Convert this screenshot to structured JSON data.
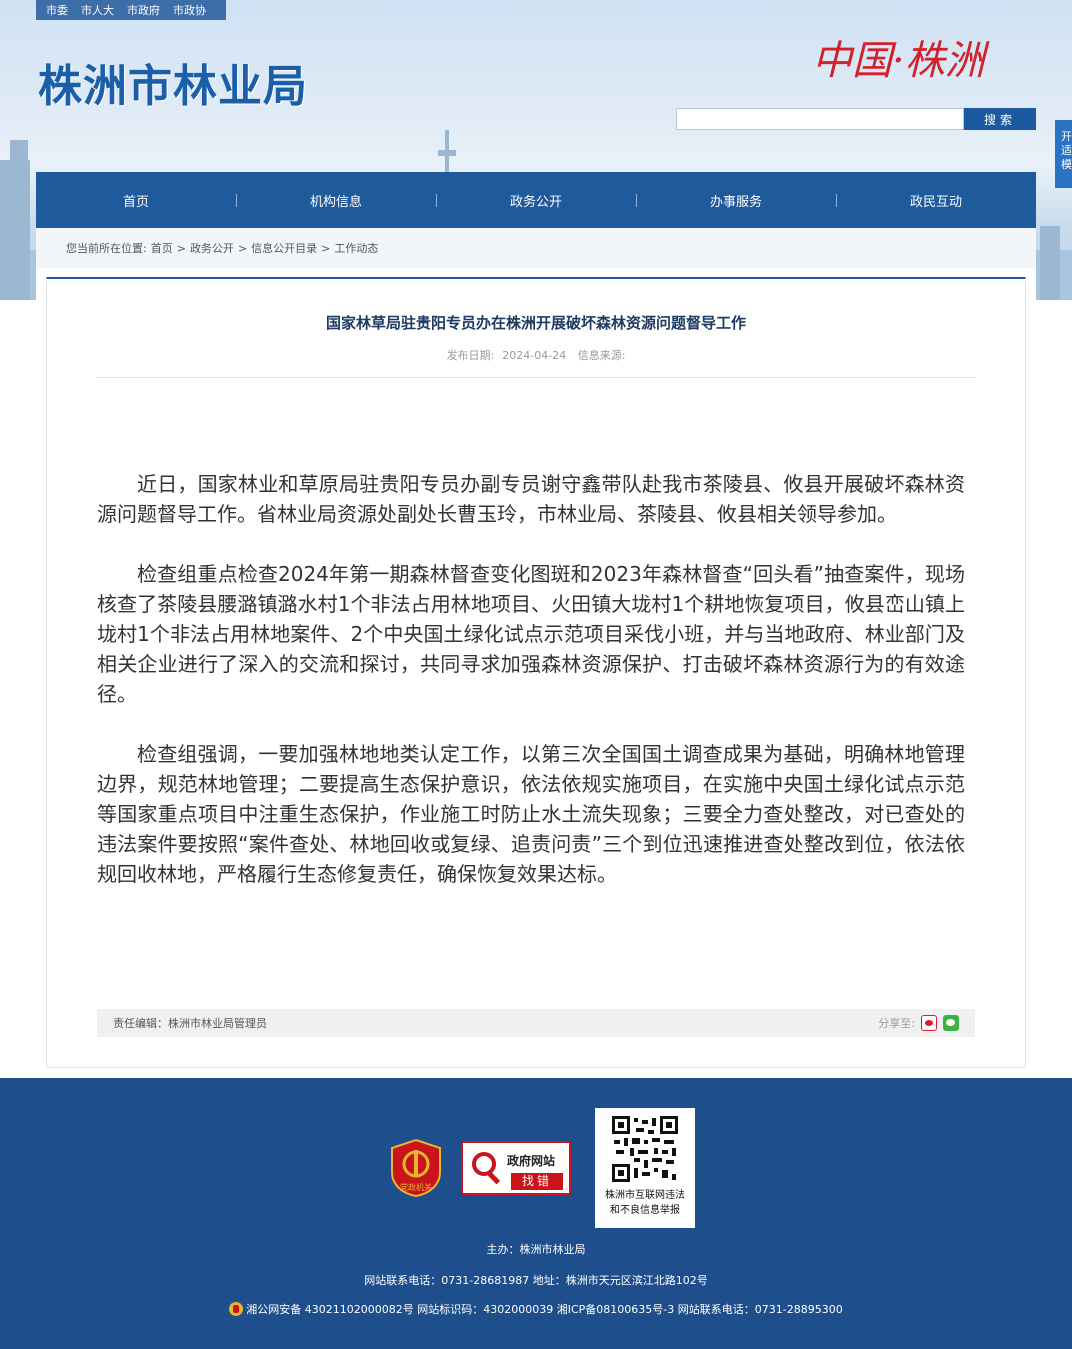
{
  "topbar": {
    "links": [
      "市委",
      "市人大",
      "市政府",
      "市政协"
    ]
  },
  "header": {
    "site_title": "株洲市林业局",
    "calligraphy": "中国·株洲",
    "search_button": "搜索",
    "side_float": "开 适 模"
  },
  "nav": {
    "items": [
      "首页",
      "机构信息",
      "政务公开",
      "办事服务",
      "政民互动"
    ]
  },
  "breadcrumb": {
    "prefix": "您当前所在位置:",
    "items": [
      "首页",
      "政务公开",
      "信息公开目录",
      "工作动态"
    ],
    "sep": ">"
  },
  "article": {
    "title": "国家林草局驻贵阳专员办在株洲开展破坏森林资源问题督导工作",
    "date_label": "发布日期:",
    "date": "2024-04-24",
    "source_label": "信息来源:",
    "paragraphs": [
      "近日，国家林业和草原局驻贵阳专员办副专员谢守鑫带队赴我市茶陵县、攸县开展破坏森林资源问题督导工作。省林业局资源处副处长曹玉玲，市林业局、茶陵县、攸县相关领导参加。",
      "检查组重点检查2024年第一期森林督查变化图斑和2023年森林督查“回头看”抽查案件，现场核查了茶陵县腰潞镇潞水村1个非法占用林地项目、火田镇大垅村1个耕地恢复项目，攸县峦山镇上垅村1个非法占用林地案件、2个中央国土绿化试点示范项目采伐小班，并与当地政府、林业部门及相关企业进行了深入的交流和探讨，共同寻求加强森林资源保护、打击破坏森林资源行为的有效途径。",
      "检查组强调，一要加强林地地类认定工作，以第三次全国国土调查成果为基础，明确林地管理边界，规范林地管理；二要提高生态保护意识，依法依规实施项目，在实施中央国土绿化试点示范等国家重点项目中注重生态保护，作业施工时防止水土流失现象；三要全力查处整改，对已查处的违法案件要按照“案件查处、林地回收或复绿、追责问责”三个到位迅速推进查处整改到位，依法依规回收林地，严格履行生态修复责任，确保恢复效果达标。"
    ],
    "editor": "责任编辑：株洲市林业局管理员",
    "share_label": "分享至:"
  },
  "footer": {
    "party_badge": "党政机关",
    "error_title": "政府网站",
    "error_button": "找错",
    "qr_caption_1": "株洲市互联网违法",
    "qr_caption_2": "和不良信息举报",
    "host": "主办：株洲市林业局",
    "contact": "网站联系电话：0731-28681987 地址：株洲市天元区滨江北路102号",
    "record": "湘公网安备 43021102000082号 网站标识码：4302000039 湘ICP备08100635号-3 网站联系电话：0731-28895300"
  },
  "colors": {
    "nav_bg": "#1e5a9c",
    "footer_bg": "#1e4f8c",
    "title_blue": "#1a5fa8",
    "accent_red": "#c8141a"
  }
}
